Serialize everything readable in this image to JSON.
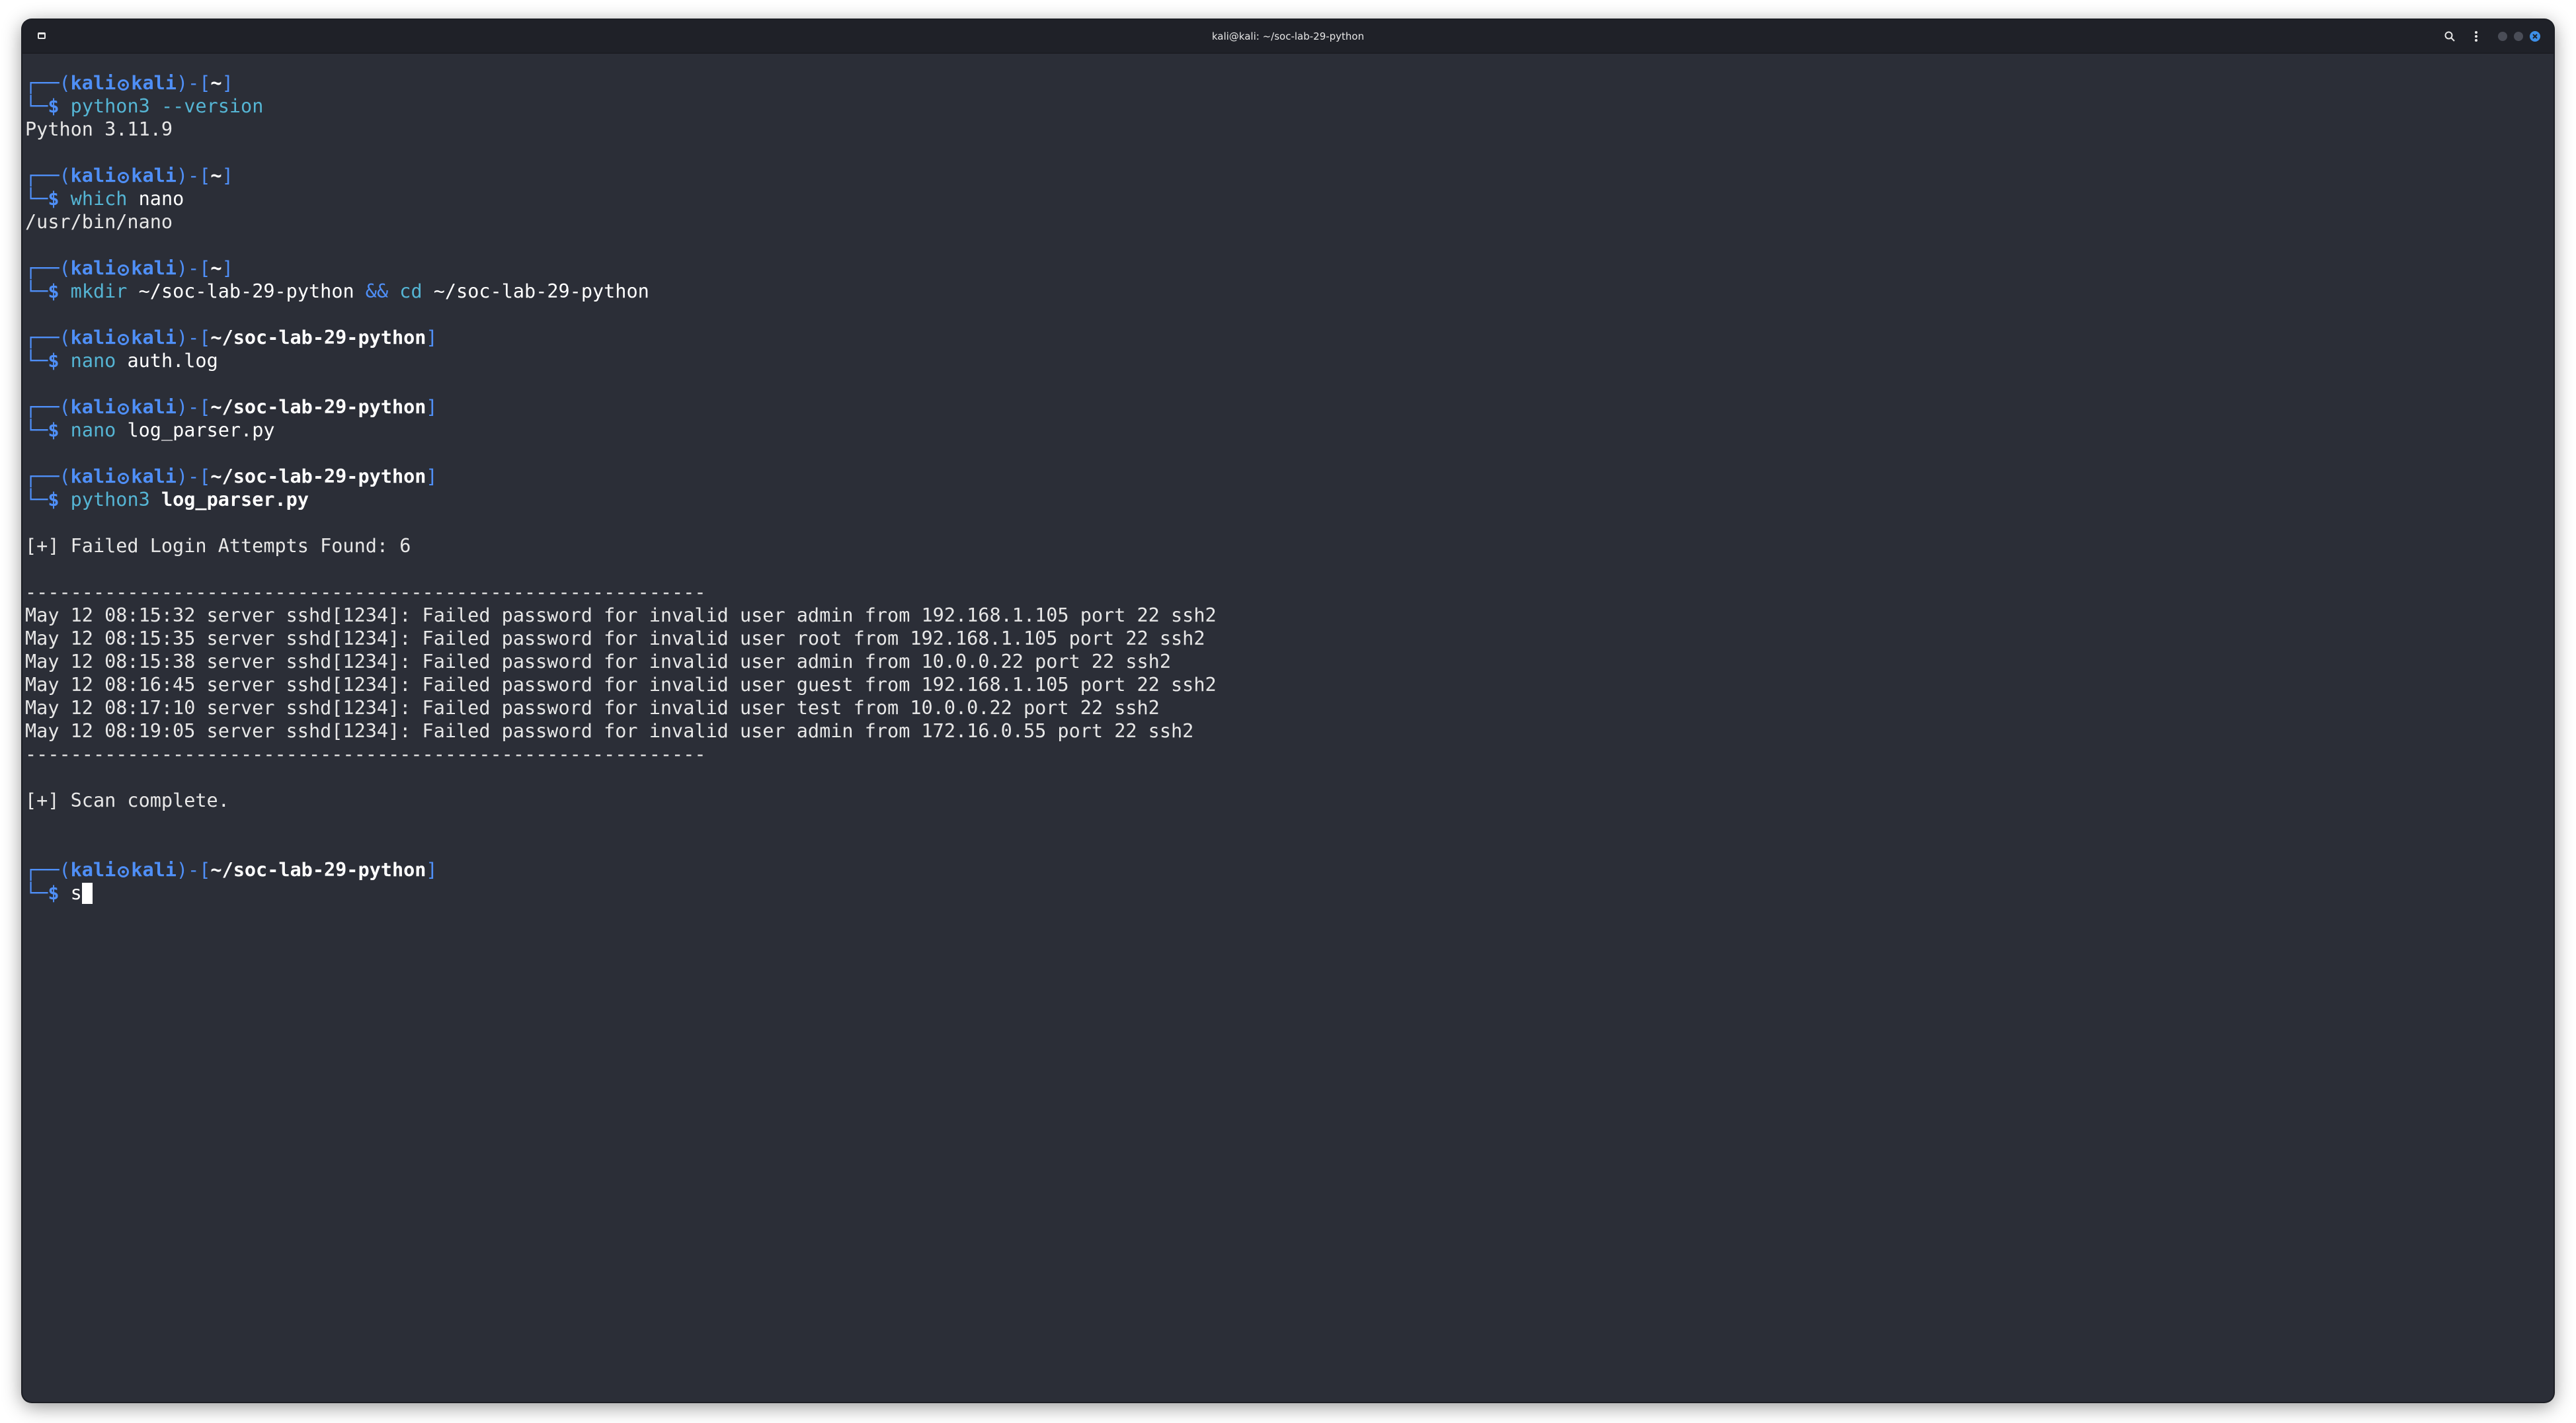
{
  "window": {
    "title": "kali@kali: ~/soc-lab-29-python"
  },
  "colors": {
    "background": "#2b2e37",
    "prompt_blue": "#4f8ff7",
    "command_cyan": "#55b5d4",
    "text": "#e7e7e7"
  },
  "icons": {
    "app": "terminal-app-icon",
    "search": "search-icon",
    "menu": "kebab-menu-icon",
    "close": "close-icon"
  },
  "prompt": {
    "user": "kali",
    "host": "kali",
    "symbol": "$"
  },
  "session": {
    "p1": {
      "dir": "~",
      "cmd": "python3",
      "args": " --version"
    },
    "out1": "Python 3.11.9",
    "p2": {
      "dir": "~",
      "cmd": "which",
      "args": " nano"
    },
    "out2": "/usr/bin/nano",
    "p3": {
      "dir": "~",
      "cmd": "mkdir",
      "args1": " ~/soc-lab-29-python ",
      "op": "&&",
      "cmd2": " cd",
      "args2": " ~/soc-lab-29-python"
    },
    "p4": {
      "dir": "~/soc-lab-29-python",
      "cmd": "nano",
      "args": " auth.log"
    },
    "p5": {
      "dir": "~/soc-lab-29-python",
      "cmd": "nano",
      "args": " log_parser.py"
    },
    "p6": {
      "dir": "~/soc-lab-29-python",
      "cmd": "python3",
      "args": " log_parser.py"
    },
    "out_found": "[+] Failed Login Attempts Found: 6",
    "separator": "------------------------------------------------------------",
    "log_lines": [
      "May 12 08:15:32 server sshd[1234]: Failed password for invalid user admin from 192.168.1.105 port 22 ssh2",
      "May 12 08:15:35 server sshd[1234]: Failed password for invalid user root from 192.168.1.105 port 22 ssh2",
      "May 12 08:15:38 server sshd[1234]: Failed password for invalid user admin from 10.0.0.22 port 22 ssh2",
      "May 12 08:16:45 server sshd[1234]: Failed password for invalid user guest from 192.168.1.105 port 22 ssh2",
      "May 12 08:17:10 server sshd[1234]: Failed password for invalid user test from 10.0.0.22 port 22 ssh2",
      "May 12 08:19:05 server sshd[1234]: Failed password for invalid user admin from 172.16.0.55 port 22 ssh2"
    ],
    "out_complete": "[+] Scan complete.",
    "p7": {
      "dir": "~/soc-lab-29-python",
      "input": "s"
    }
  }
}
